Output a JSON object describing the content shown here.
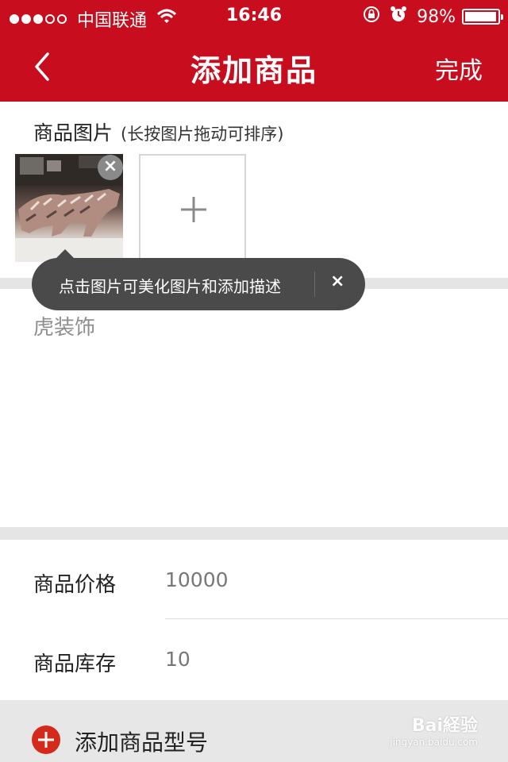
{
  "status_bar": {
    "carrier": "中国联通",
    "time": "16:46",
    "battery_percent": "98%",
    "battery_level": 0.98,
    "signal_dots_filled": 3,
    "signal_dots_total": 5
  },
  "nav": {
    "title": "添加商品",
    "done_label": "完成",
    "back_icon": "chevron-left-icon"
  },
  "images_section": {
    "title": "商品图片",
    "hint": "(长按图片拖动可排序)",
    "remove_symbol": "×",
    "add_icon": "plus-icon"
  },
  "tooltip": {
    "text": "点击图片可美化图片和添加描述",
    "close_symbol": "×"
  },
  "description": {
    "value": "虎装饰"
  },
  "price": {
    "label": "商品价格",
    "value": "10000"
  },
  "stock": {
    "label": "商品库存",
    "value": "10"
  },
  "add_model": {
    "label": "添加商品型号",
    "icon": "plus-circle-icon"
  },
  "watermark": {
    "text": "Bai経验",
    "sub": "jingyan.baidu.com"
  },
  "colors": {
    "brand_red": "#c80e1e",
    "tooltip_bg": "#4a4a4a",
    "divider": "#e5e5e5"
  }
}
